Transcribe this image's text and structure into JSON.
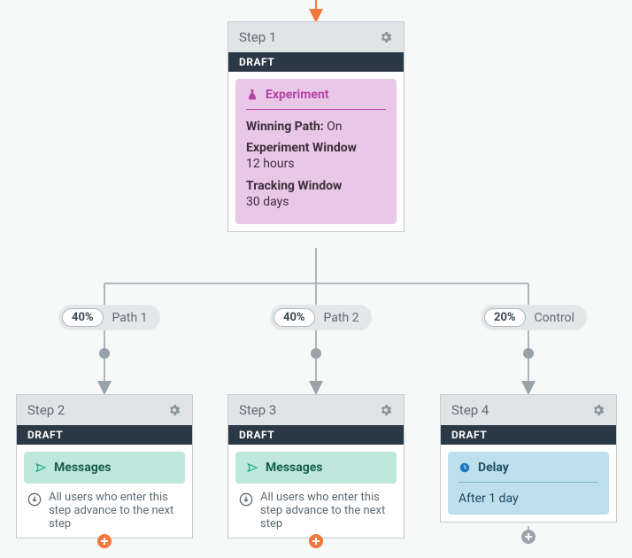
{
  "entryArrowColor": "#f0783c",
  "step1": {
    "title": "Step 1",
    "status": "DRAFT",
    "experiment": {
      "label": "Experiment",
      "winningPathKey": "Winning Path:",
      "winningPathVal": "On",
      "expWindowKey": "Experiment Window",
      "expWindowVal": "12 hours",
      "trackWindowKey": "Tracking Window",
      "trackWindowVal": "30 days"
    }
  },
  "paths": {
    "p1": {
      "pct": "40%",
      "label": "Path 1"
    },
    "p2": {
      "pct": "40%",
      "label": "Path 2"
    },
    "p3": {
      "pct": "20%",
      "label": "Control"
    }
  },
  "step2": {
    "title": "Step 2",
    "status": "DRAFT",
    "messagesLabel": "Messages",
    "advanceText": "All users who enter this step advance to the next step"
  },
  "step3": {
    "title": "Step 3",
    "status": "DRAFT",
    "messagesLabel": "Messages",
    "advanceText": "All users who enter this step advance to the next step"
  },
  "step4": {
    "title": "Step 4",
    "status": "DRAFT",
    "delayLabel": "Delay",
    "delayText": "After 1 day"
  }
}
